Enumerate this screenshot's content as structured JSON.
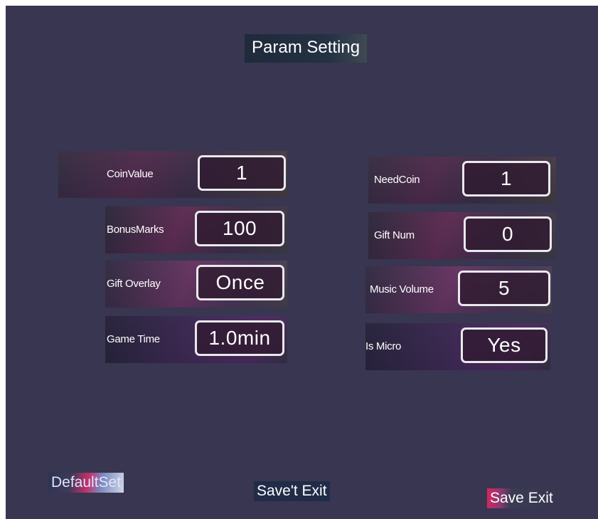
{
  "title": "Param Setting",
  "left_params": [
    {
      "label": "CoinValue",
      "value": "1",
      "selected": true
    },
    {
      "label": "BonusMarks",
      "value": "100"
    },
    {
      "label": "Gift Overlay",
      "value": "Once"
    },
    {
      "label": "Game Time",
      "value": "1.0min"
    }
  ],
  "right_params": [
    {
      "label": "NeedCoin",
      "value": "1"
    },
    {
      "label": "Gift Num",
      "value": "0"
    },
    {
      "label": "Music Volume",
      "value": "5"
    },
    {
      "label": "Is Micro",
      "value": "Yes"
    }
  ],
  "buttons": {
    "default_set": "DefaultSet",
    "save_not_exit": "Save't Exit",
    "save_exit": "Save Exit"
  },
  "icons": {
    "selection_cursor": "chevron-right-circle-icon"
  },
  "colors": {
    "background": "#383650",
    "value_border": "#e9e9ee",
    "text": "#ffffff"
  }
}
